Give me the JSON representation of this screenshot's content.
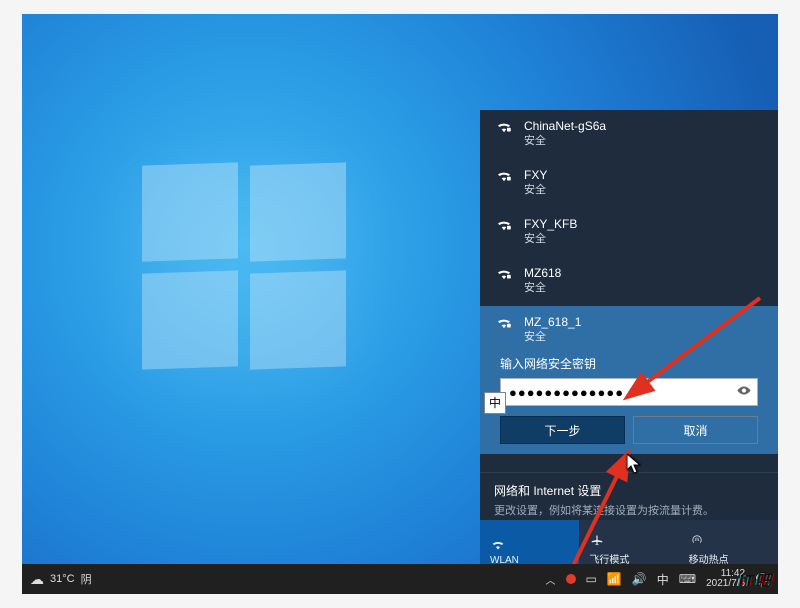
{
  "networks": [
    {
      "ssid": "ChinaNet-gS6a",
      "security": "安全"
    },
    {
      "ssid": "FXY",
      "security": "安全"
    },
    {
      "ssid": "FXY_KFB",
      "security": "安全"
    },
    {
      "ssid": "MZ618",
      "security": "安全"
    }
  ],
  "selected": {
    "ssid": "MZ_618_1",
    "security": "安全",
    "prompt": "输入网络安全密钥",
    "password_mask": "●●●●●●●●●●●●●",
    "ime_badge": "中",
    "next_btn": "下一步",
    "cancel_btn": "取消"
  },
  "settings_link": {
    "title": "网络和 Internet 设置",
    "desc": "更改设置，例如将某连接设置为按流量计费。"
  },
  "quick_actions": {
    "wlan": "WLAN",
    "airplane": "飞行模式",
    "hotspot": "移动热点"
  },
  "taskbar": {
    "weather_temp": "31°C",
    "weather_cond": "阴",
    "ime": "中",
    "time": "11:42",
    "date": "2021/7/6"
  },
  "watermark": "IT吧"
}
